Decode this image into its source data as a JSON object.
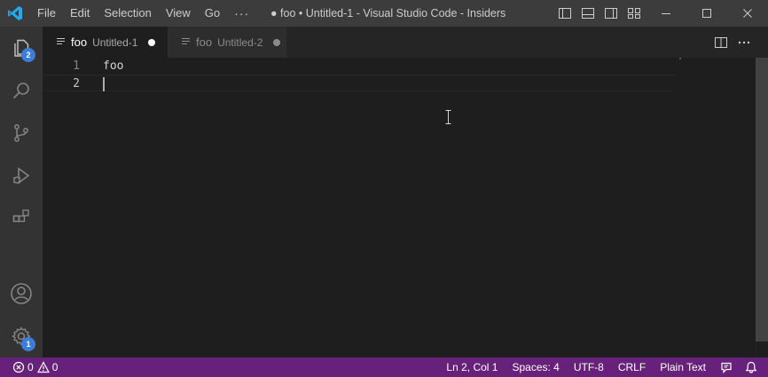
{
  "titlebar": {
    "menus": [
      "File",
      "Edit",
      "Selection",
      "View",
      "Go",
      "···"
    ],
    "title": "● foo • Untitled-1 - Visual Studio Code - Insiders"
  },
  "activitybar": {
    "explorer_badge": "2",
    "manage_badge": "1"
  },
  "tabs": [
    {
      "name": "foo",
      "description": "Untitled-1",
      "active": true,
      "dirty": true
    },
    {
      "name": "foo",
      "description": "Untitled-2",
      "active": false,
      "dirty": true
    }
  ],
  "editor": {
    "lines": [
      {
        "number": "1",
        "text": "foo"
      },
      {
        "number": "2",
        "text": ""
      }
    ]
  },
  "statusbar": {
    "errors": "0",
    "warnings": "0",
    "position": "Ln 2, Col 1",
    "indentation": "Spaces: 4",
    "encoding": "UTF-8",
    "eol": "CRLF",
    "language": "Plain Text"
  },
  "colors": {
    "statusbar_bg": "#68217a",
    "badge": "#3b7dd8"
  }
}
